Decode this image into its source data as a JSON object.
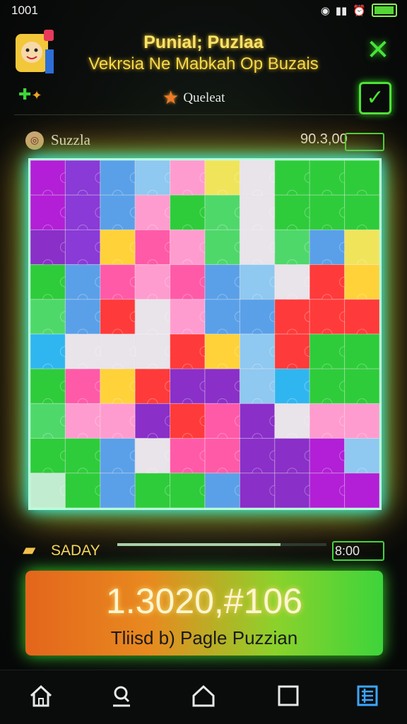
{
  "status": {
    "time": "1001"
  },
  "header": {
    "title_line1": "Punial; Puzlaa",
    "title_line2": "Vekrsia Ne Mabkah Op Buzais"
  },
  "toolbar": {
    "quest_label": "Queleat"
  },
  "panel": {
    "name": "Suzzla",
    "score": "90.3,00"
  },
  "lower": {
    "label": "SADAY",
    "time": "8:00",
    "progress": 0.78
  },
  "score_card": {
    "value": "1.3020,#106",
    "subtitle": "Tliisd b) Pagle Puzzian"
  },
  "colors": {
    "accent_green": "#3fd63a",
    "title_yellow": "#f5d94a",
    "active_nav": "#3ca7ff",
    "pieces": [
      "#b21fd6",
      "#8a3ad6",
      "#5aa0e8",
      "#8fc8f0",
      "#ff9ccf",
      "#e9e3ea",
      "#f0e45a",
      "#ff3a3a",
      "#2ecc3a",
      "#4fd86a",
      "#8a2fc8",
      "#ffd23a",
      "#ff5aa8",
      "#2fb6f0",
      "#c2ecd0"
    ]
  },
  "board": {
    "rows": 10,
    "cols": 10,
    "cells": [
      [
        0,
        1,
        2,
        3,
        4,
        6,
        5,
        8,
        8,
        8
      ],
      [
        0,
        1,
        2,
        4,
        8,
        9,
        5,
        8,
        8,
        8
      ],
      [
        10,
        1,
        11,
        12,
        4,
        9,
        5,
        9,
        2,
        6
      ],
      [
        8,
        2,
        12,
        4,
        12,
        2,
        3,
        5,
        7,
        11
      ],
      [
        9,
        2,
        7,
        5,
        4,
        2,
        2,
        7,
        7,
        7
      ],
      [
        13,
        5,
        5,
        5,
        7,
        11,
        3,
        7,
        8,
        8
      ],
      [
        8,
        12,
        11,
        7,
        10,
        10,
        3,
        13,
        8,
        8
      ],
      [
        9,
        4,
        4,
        10,
        7,
        12,
        10,
        5,
        4,
        4
      ],
      [
        8,
        8,
        2,
        5,
        12,
        12,
        10,
        10,
        0,
        3
      ],
      [
        14,
        8,
        2,
        8,
        8,
        2,
        10,
        10,
        0,
        0
      ]
    ]
  },
  "nav": {
    "items": [
      {
        "icon": "home-icon"
      },
      {
        "icon": "puzzle-search-icon"
      },
      {
        "icon": "house-outline-icon"
      },
      {
        "icon": "square-icon"
      },
      {
        "icon": "list-icon"
      }
    ]
  }
}
